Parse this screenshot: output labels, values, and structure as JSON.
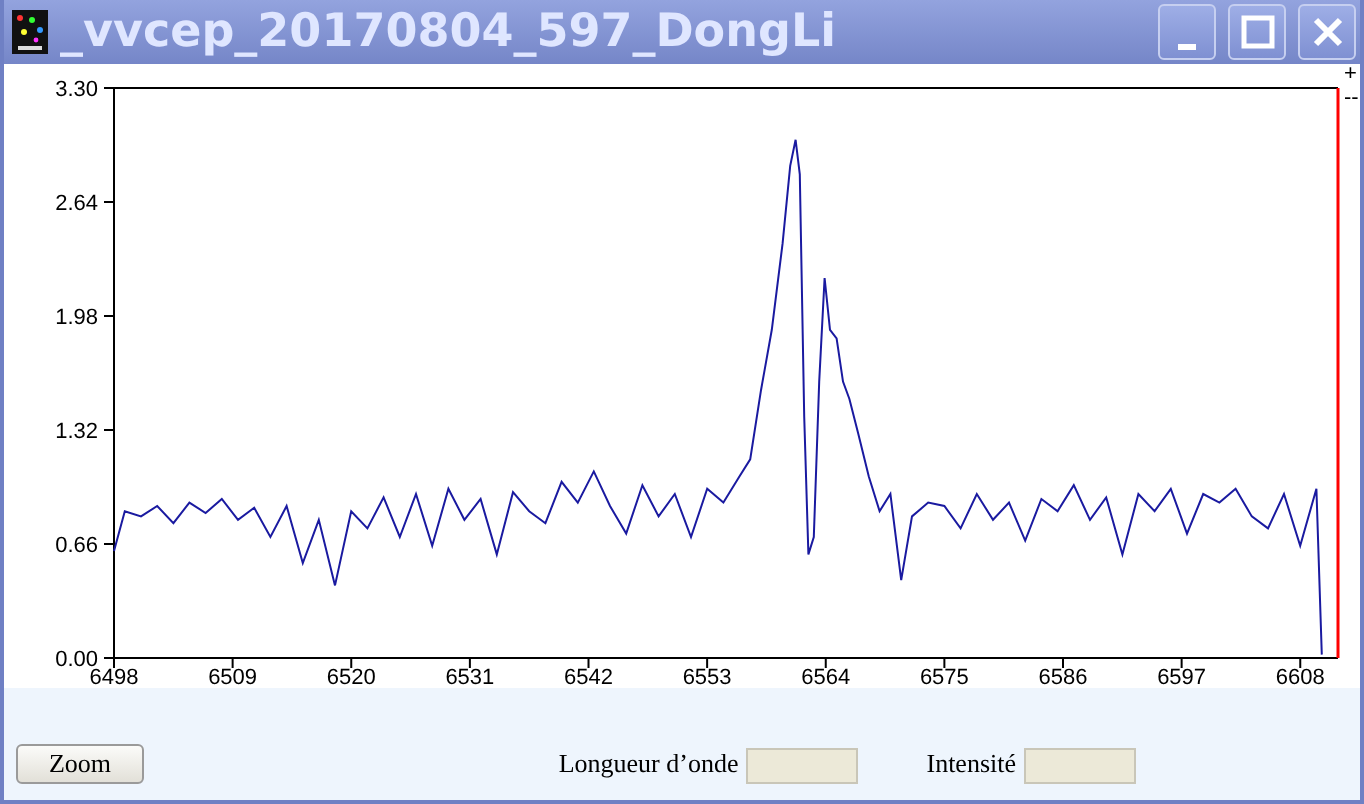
{
  "window": {
    "title": "_vvcep_20170804_597_DongLi"
  },
  "plot_controls": [
    "+",
    "--"
  ],
  "chart": {
    "chart_data": {
      "type": "line",
      "xlim": [
        6498,
        6611.5
      ],
      "ylim": [
        0,
        3.3
      ],
      "xticks": [
        6498,
        6509,
        6520,
        6531,
        6542,
        6553,
        6564,
        6575,
        6586,
        6597,
        6608
      ],
      "yticks": [
        {
          "value": 0,
          "label": "0.00"
        },
        {
          "value": 0.66,
          "label": "0.66"
        },
        {
          "value": 1.32,
          "label": "1.32"
        },
        {
          "value": 1.98,
          "label": "1.98"
        },
        {
          "value": 2.64,
          "label": "2.64"
        },
        {
          "value": 3.3,
          "label": "3.30"
        }
      ],
      "x": [
        6498,
        6499,
        6500.5,
        6502,
        6503.5,
        6505,
        6506.5,
        6508,
        6509.5,
        6511,
        6512.5,
        6514,
        6515.5,
        6517,
        6518.5,
        6520,
        6521.5,
        6523,
        6524.5,
        6526,
        6527.5,
        6529,
        6530.5,
        6532,
        6533.5,
        6535,
        6536.5,
        6538,
        6539.5,
        6541,
        6542.5,
        6544,
        6545.5,
        6547,
        6548.5,
        6550,
        6551.5,
        6553,
        6554.5,
        6556,
        6557,
        6558,
        6559,
        6560,
        6560.7,
        6561.2,
        6561.6,
        6562,
        6562.4,
        6562.9,
        6563.4,
        6563.9,
        6564.4,
        6565,
        6565.6,
        6566.2,
        6567,
        6568,
        6569,
        6570,
        6571,
        6572,
        6573.5,
        6575,
        6576.5,
        6578,
        6579.5,
        6581,
        6582.5,
        6584,
        6585.5,
        6587,
        6588.5,
        6590,
        6591.5,
        6593,
        6594.5,
        6596,
        6597.5,
        6599,
        6600.5,
        6602,
        6603.5,
        6605,
        6606.5,
        6608,
        6609.5,
        6610
      ],
      "series": [
        {
          "color": "#1a1aa0",
          "values": [
            0.62,
            0.85,
            0.82,
            0.88,
            0.78,
            0.9,
            0.84,
            0.92,
            0.8,
            0.87,
            0.7,
            0.88,
            0.55,
            0.8,
            0.42,
            0.85,
            0.75,
            0.93,
            0.7,
            0.95,
            0.65,
            0.98,
            0.8,
            0.92,
            0.6,
            0.96,
            0.85,
            0.78,
            1.02,
            0.9,
            1.08,
            0.88,
            0.72,
            1.0,
            0.82,
            0.95,
            0.7,
            0.98,
            0.9,
            1.05,
            1.15,
            1.55,
            1.9,
            2.4,
            2.85,
            3.0,
            2.8,
            1.4,
            0.6,
            0.7,
            1.6,
            2.2,
            1.9,
            1.85,
            1.6,
            1.5,
            1.3,
            1.05,
            0.85,
            0.95,
            0.45,
            0.82,
            0.9,
            0.88,
            0.75,
            0.95,
            0.8,
            0.9,
            0.68,
            0.92,
            0.85,
            1.0,
            0.8,
            0.93,
            0.6,
            0.95,
            0.85,
            0.98,
            0.72,
            0.95,
            0.9,
            0.98,
            0.82,
            0.75,
            0.95,
            0.65,
            0.98,
            0.02
          ]
        }
      ]
    }
  },
  "bottom_bar": {
    "zoom_button": "Zoom",
    "wavelength": {
      "label": "Longueur d’onde"
    },
    "intensity": {
      "label": "Intensité"
    }
  }
}
